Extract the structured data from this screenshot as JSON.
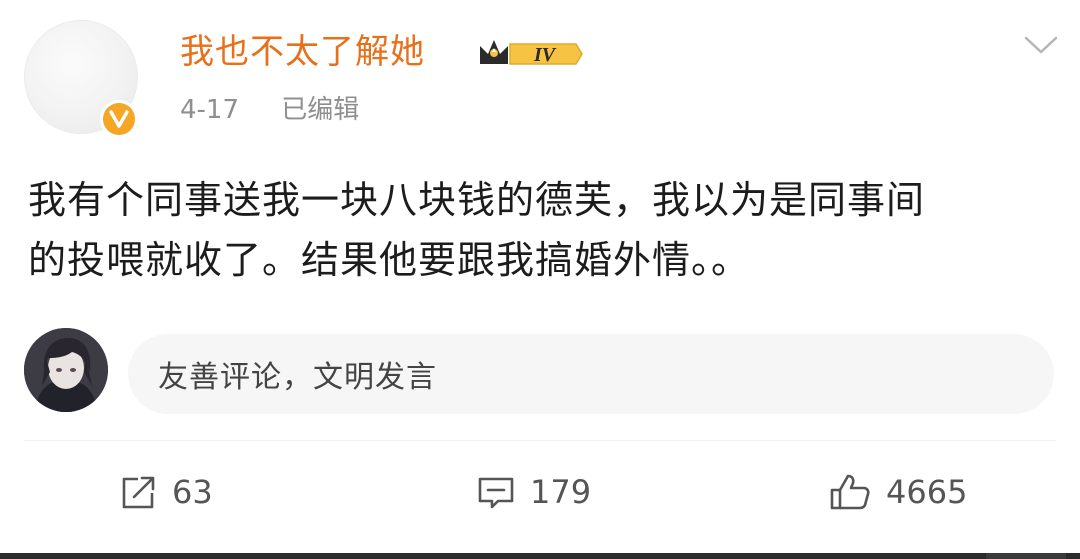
{
  "post": {
    "author": {
      "name": "我也不太了解她",
      "vip_level": "IV"
    },
    "date": "4-17",
    "edited_label": "已编辑",
    "text_line1": "我有个同事送我一块八块钱的德芙，我以为是同事间",
    "text_line2": "的投喂就收了。结果他要跟我搞婚外情。。"
  },
  "comment_box": {
    "placeholder": "友善评论，文明发言"
  },
  "actions": {
    "repost_count": "63",
    "comment_count": "179",
    "like_count": "4665"
  },
  "colors": {
    "username": "#e8701a",
    "verified_badge": "#f5a623",
    "meta_text": "#8f8f8f",
    "body_text": "#1c1c1c"
  },
  "icons": {
    "verified": "verified-v-icon",
    "vip": "crown-vip-icon",
    "more": "chevron-down-icon",
    "repost": "repost-icon",
    "comment": "comment-icon",
    "like": "thumbs-up-icon"
  }
}
